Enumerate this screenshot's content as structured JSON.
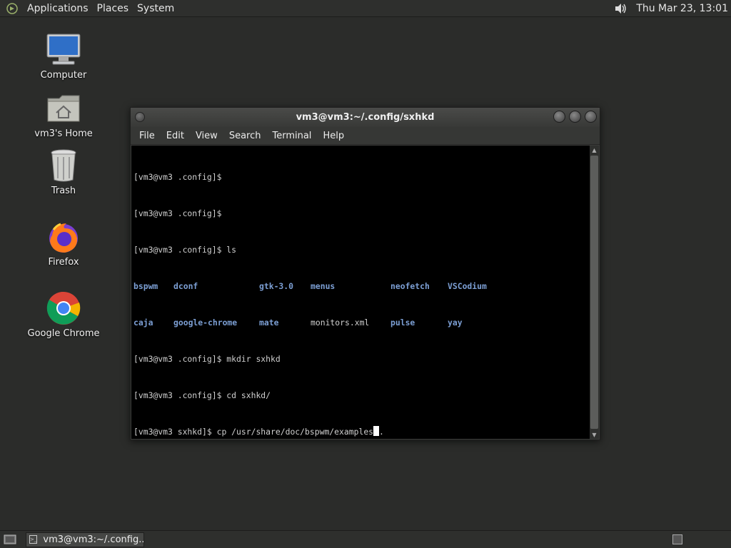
{
  "top_panel": {
    "menus": [
      "Applications",
      "Places",
      "System"
    ],
    "clock": "Thu Mar 23, 13:01",
    "logo_icon": "mate-logo-icon",
    "volume_icon": "speaker-icon"
  },
  "desktop_icons": [
    {
      "label": "Computer",
      "icon": "computer-icon"
    },
    {
      "label": "vm3's Home",
      "icon": "home-folder-icon"
    },
    {
      "label": "Trash",
      "icon": "trash-icon"
    },
    {
      "label": "Firefox",
      "icon": "firefox-icon"
    },
    {
      "label": "Google Chrome",
      "icon": "chrome-icon"
    }
  ],
  "window": {
    "title": "vm3@vm3:~/.config/sxhkd",
    "menu": [
      "File",
      "Edit",
      "View",
      "Search",
      "Terminal",
      "Help"
    ]
  },
  "terminal": {
    "lines": [
      "[vm3@vm3 .config]$",
      "[vm3@vm3 .config]$",
      "[vm3@vm3 .config]$ ls"
    ],
    "ls_rows": [
      [
        {
          "name": "bspwm",
          "type": "dir"
        },
        {
          "name": "dconf",
          "type": "dir"
        },
        {
          "name": "gtk-3.0",
          "type": "dir"
        },
        {
          "name": "menus",
          "type": "dir"
        },
        {
          "name": "neofetch",
          "type": "dir"
        },
        {
          "name": "VSCodium",
          "type": "dir"
        }
      ],
      [
        {
          "name": "caja",
          "type": "dir"
        },
        {
          "name": "google-chrome",
          "type": "dir"
        },
        {
          "name": "mate",
          "type": "dir"
        },
        {
          "name": "monitors.xml",
          "type": "file"
        },
        {
          "name": "pulse",
          "type": "dir"
        },
        {
          "name": "yay",
          "type": "dir"
        }
      ]
    ],
    "after_lines": [
      "[vm3@vm3 .config]$ mkdir sxhkd",
      "[vm3@vm3 .config]$ cd sxhkd/"
    ],
    "current_prompt": "[vm3@vm3 sxhkd]$ cp /usr/share/doc/bspwm/examples",
    "after_cursor": "."
  },
  "taskbar": {
    "task_label": "vm3@vm3:~/.config...",
    "show_desktop_icon": "show-desktop-icon",
    "terminal_icon": "terminal-icon"
  },
  "colors": {
    "desktop_bg": "#2b2c2a",
    "dir_color": "#7c9fd4"
  }
}
